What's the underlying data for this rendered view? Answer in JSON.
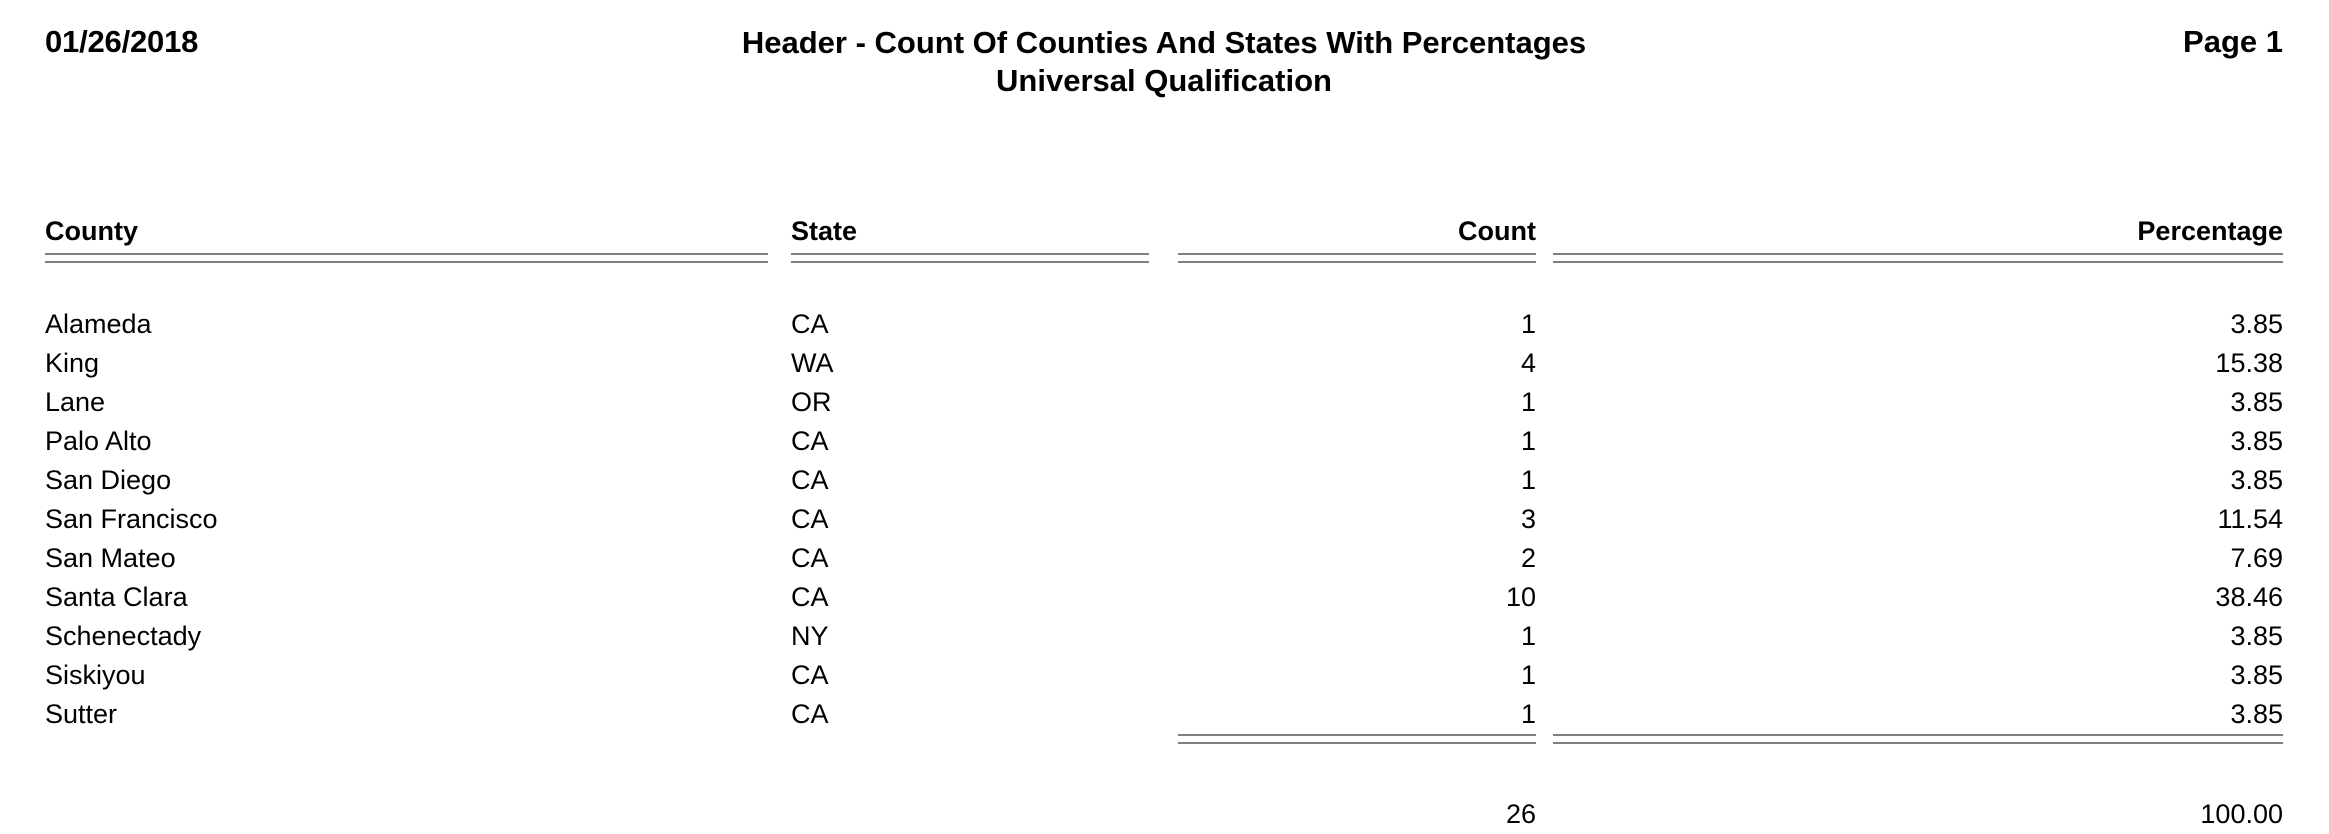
{
  "header": {
    "date": "01/26/2018",
    "title": "Header - Count Of Counties And States With Percentages",
    "subtitle": "Universal Qualification",
    "page_label": "Page 1"
  },
  "table": {
    "columns": {
      "county": "County",
      "state": "State",
      "count": "Count",
      "percentage": "Percentage"
    },
    "rows": [
      {
        "county": "Alameda",
        "state": "CA",
        "count": "1",
        "percentage": "3.85"
      },
      {
        "county": "King",
        "state": "WA",
        "count": "4",
        "percentage": "15.38"
      },
      {
        "county": "Lane",
        "state": "OR",
        "count": "1",
        "percentage": "3.85"
      },
      {
        "county": "Palo Alto",
        "state": "CA",
        "count": "1",
        "percentage": "3.85"
      },
      {
        "county": "San Diego",
        "state": "CA",
        "count": "1",
        "percentage": "3.85"
      },
      {
        "county": "San Francisco",
        "state": "CA",
        "count": "3",
        "percentage": "11.54"
      },
      {
        "county": "San Mateo",
        "state": "CA",
        "count": "2",
        "percentage": "7.69"
      },
      {
        "county": "Santa Clara",
        "state": "CA",
        "count": "10",
        "percentage": "38.46"
      },
      {
        "county": "Schenectady",
        "state": "NY",
        "count": "1",
        "percentage": "3.85"
      },
      {
        "county": "Siskiyou",
        "state": "CA",
        "count": "1",
        "percentage": "3.85"
      },
      {
        "county": "Sutter",
        "state": "CA",
        "count": "1",
        "percentage": "3.85"
      }
    ],
    "totals": {
      "county": "",
      "state": "",
      "count": "26",
      "percentage": "100.00"
    }
  },
  "colors": {
    "text": "#000000",
    "rule": "#808080",
    "background": "#ffffff"
  }
}
